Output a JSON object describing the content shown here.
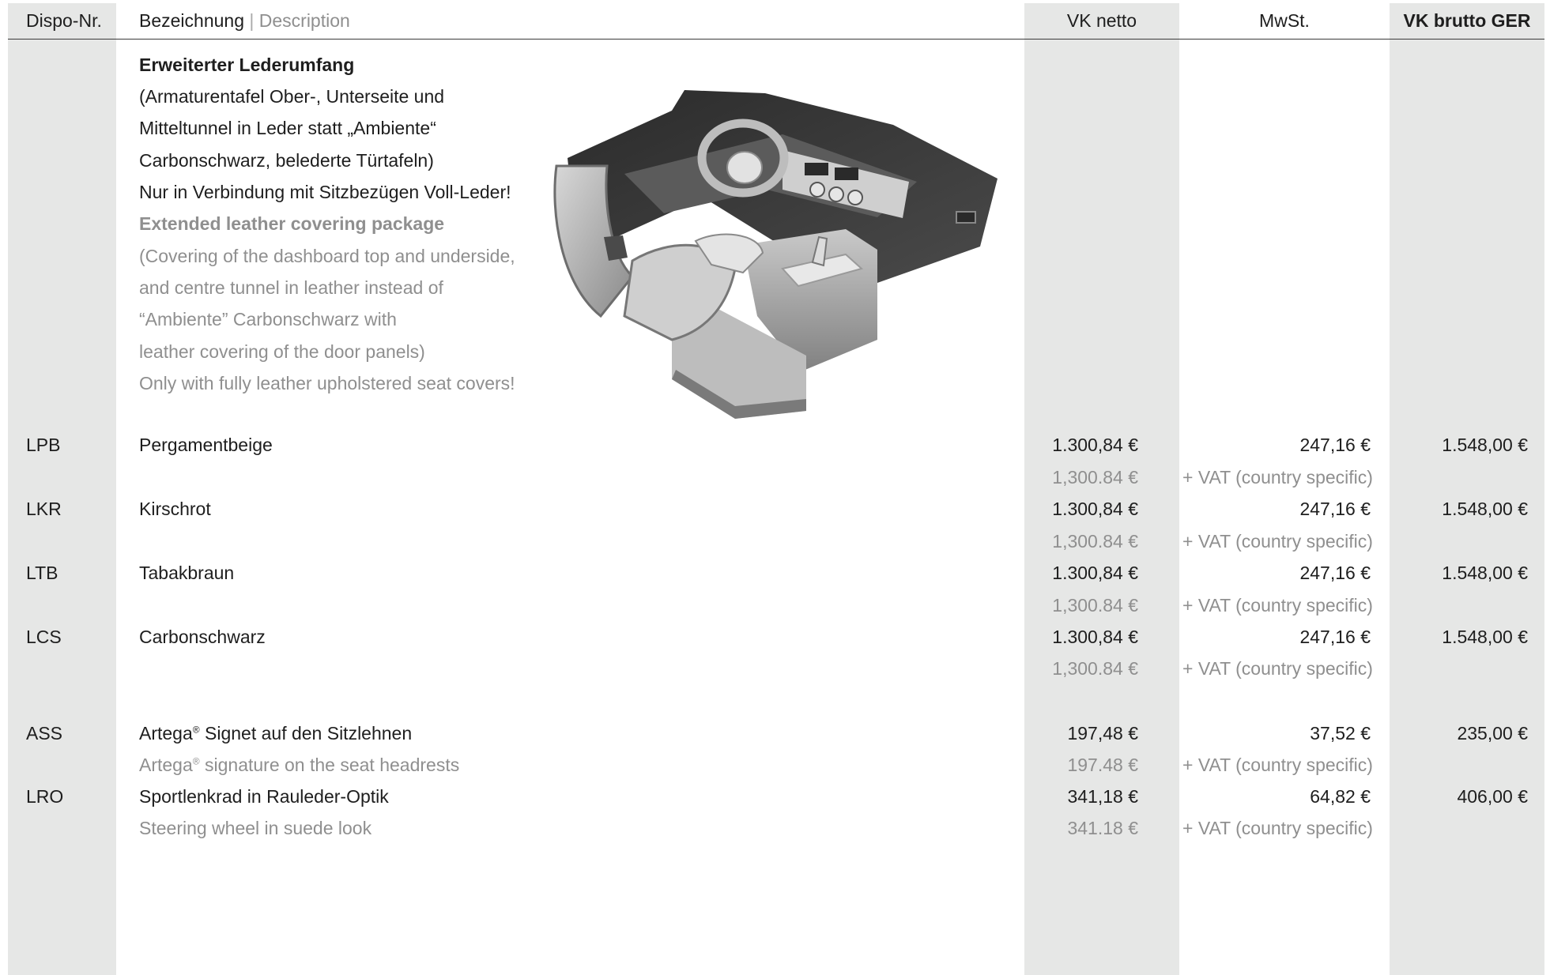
{
  "header": {
    "dispo": "Dispo-Nr.",
    "bezeichnung": "Bezeichnung",
    "separator": "|",
    "description": "Description",
    "vk_netto": "VK netto",
    "mwst": "MwSt.",
    "vk_brutto": "VK brutto GER"
  },
  "intro": {
    "title_de": "Erweiterter Lederumfang",
    "lines_de": [
      "(Armaturentafel Ober-, Unterseite und",
      "Mitteltunnel in Leder statt „Ambiente“",
      "Carbonschwarz, belederte Türtafeln)",
      "Nur in Verbindung mit Sitzbezügen Voll-Leder!"
    ],
    "title_en": "Extended leather covering package",
    "lines_en": [
      "(Covering of the dashboard top and underside,",
      "and centre tunnel in leather instead of",
      "“Ambiente” Carbonschwarz with",
      "leather covering of the door panels)",
      "Only with fully leather upholstered seat covers!"
    ]
  },
  "items": [
    {
      "code": "LPB",
      "name": "Pergamentbeige",
      "netto": "1.300,84 €",
      "mwst": "247,16 €",
      "brutto": "1.548,00 €",
      "netto_en": "1,300.84 €",
      "vat_en": "+ VAT (country specific)"
    },
    {
      "code": "LKR",
      "name": "Kirschrot",
      "netto": "1.300,84 €",
      "mwst": "247,16 €",
      "brutto": "1.548,00 €",
      "netto_en": "1,300.84 €",
      "vat_en": "+ VAT (country specific)"
    },
    {
      "code": "LTB",
      "name": "Tabakbraun",
      "netto": "1.300,84 €",
      "mwst": "247,16 €",
      "brutto": "1.548,00 €",
      "netto_en": "1,300.84 €",
      "vat_en": "+ VAT (country specific)"
    },
    {
      "code": "LCS",
      "name": "Carbonschwarz",
      "netto": "1.300,84 €",
      "mwst": "247,16 €",
      "brutto": "1.548,00 €",
      "netto_en": "1,300.84 €",
      "vat_en": "+ VAT (country specific)"
    },
    {
      "code": "ASS",
      "name": "Artega",
      "name_rest": " Signet auf den Sitzlehnen",
      "name_en": "Artega",
      "name_en_rest": " signature on the seat headrests",
      "reg": "®",
      "netto": "197,48 €",
      "mwst": "37,52 €",
      "brutto": "235,00 €",
      "netto_en": "197.48 €",
      "vat_en": "+ VAT (country specific)"
    },
    {
      "code": "LRO",
      "name": "Sportlenkrad in Rauleder-Optik",
      "name_en": "Steering wheel in suede look",
      "netto": "341,18 €",
      "mwst": "64,82 €",
      "brutto": "406,00 €",
      "netto_en": "341.18 €",
      "vat_en": "+ VAT (country specific)"
    }
  ]
}
